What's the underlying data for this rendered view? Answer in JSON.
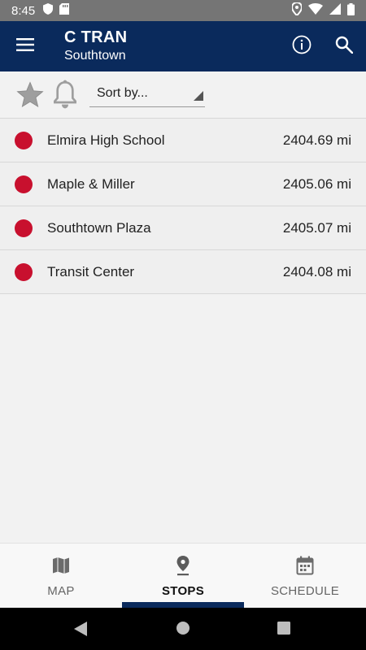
{
  "status_bar": {
    "time": "8:45",
    "icons": [
      "shield-icon",
      "sd-card-icon",
      "location-icon",
      "wifi-icon",
      "signal-icon",
      "battery-icon"
    ]
  },
  "app_bar": {
    "title": "C TRAN",
    "subtitle": "Southtown",
    "icons": [
      "menu-icon",
      "info-icon",
      "search-icon"
    ]
  },
  "toolbar": {
    "sort_label": "Sort by...",
    "icons": [
      "star-icon",
      "bell-icon"
    ]
  },
  "stops": [
    {
      "name": "Elmira High School",
      "distance": "2404.69 mi"
    },
    {
      "name": "Maple & Miller",
      "distance": "2405.06 mi"
    },
    {
      "name": "Southtown Plaza",
      "distance": "2405.07 mi"
    },
    {
      "name": "Transit Center",
      "distance": "2404.08 mi"
    }
  ],
  "bottom_nav": {
    "tabs": [
      {
        "label": "MAP",
        "icon": "map-icon"
      },
      {
        "label": "STOPS",
        "icon": "location-pin-icon"
      },
      {
        "label": "SCHEDULE",
        "icon": "calendar-icon"
      }
    ],
    "active": "STOPS"
  },
  "colors": {
    "app_bar": "#0a2a5c",
    "stop_dot": "#c8102e",
    "status_bar": "#757575",
    "background": "#f2f2f2"
  }
}
